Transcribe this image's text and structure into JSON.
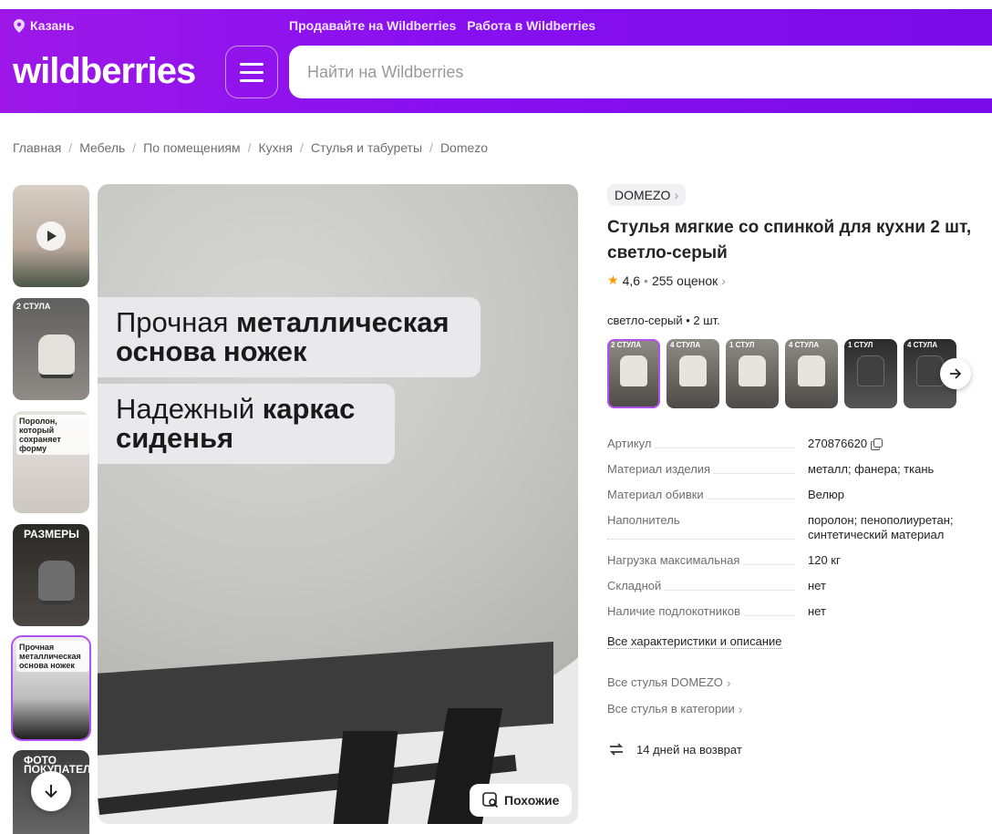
{
  "header": {
    "city": "Казань",
    "links": [
      "Продавайте на Wildberries",
      "Работа в Wildberries"
    ],
    "logo": "wildberries",
    "search_placeholder": "Найти на Wildberries"
  },
  "breadcrumb": [
    "Главная",
    "Мебель",
    "По помещениям",
    "Кухня",
    "Стулья и табуреты",
    "Domezo"
  ],
  "gallery": {
    "thumb_captions": [
      "",
      "2 СТУЛА",
      "Поролон, который сохраняет форму",
      "РАЗМЕРЫ",
      "Прочная металлическая основа ножек",
      "ФОТО ПОКУПАТЕЛЕЙ"
    ],
    "main_text_1_regular": "Прочная ",
    "main_text_1_bold": "металлическая основа ножек",
    "main_text_2_regular": "Надежный ",
    "main_text_2_bold": "каркас сиденья",
    "similar_button": "Похожие"
  },
  "product": {
    "brand": "DOMEZO",
    "title": "Стулья мягкие со спинкой для кухни 2 шт, светло-серый",
    "rating": "4,6",
    "reviews": "255 оценок",
    "variant_label": "светло-серый • 2 шт.",
    "variants": [
      {
        "caption": "2 СТУЛА",
        "style": "light"
      },
      {
        "caption": "4 СТУЛА",
        "style": "light"
      },
      {
        "caption": "1 СТУЛ",
        "style": "light"
      },
      {
        "caption": "4 СТУЛА",
        "style": "light"
      },
      {
        "caption": "1 СТУЛ",
        "style": "dark"
      },
      {
        "caption": "4 СТУЛА",
        "style": "dark"
      }
    ]
  },
  "specs": [
    {
      "name": "Артикул",
      "value": "270876620"
    },
    {
      "name": "Материал изделия",
      "value": "металл; фанера; ткань"
    },
    {
      "name": "Материал обивки",
      "value": "Велюр"
    },
    {
      "name": "Наполнитель",
      "value": "поролон; пенополиуретан; синтетический материал"
    },
    {
      "name": "Нагрузка максимальная",
      "value": "120 кг"
    },
    {
      "name": "Складной",
      "value": "нет"
    },
    {
      "name": "Наличие подлокотников",
      "value": "нет"
    }
  ],
  "links": {
    "all_specs": "Все характеристики и описание",
    "all_brand": "Все стулья DOMEZO",
    "all_category": "Все стулья в категории"
  },
  "return_policy": "14 дней на возврат",
  "colors": {
    "brand_purple": "#8810f0",
    "accent_outline": "#b44ff0",
    "star": "#ff9900"
  }
}
